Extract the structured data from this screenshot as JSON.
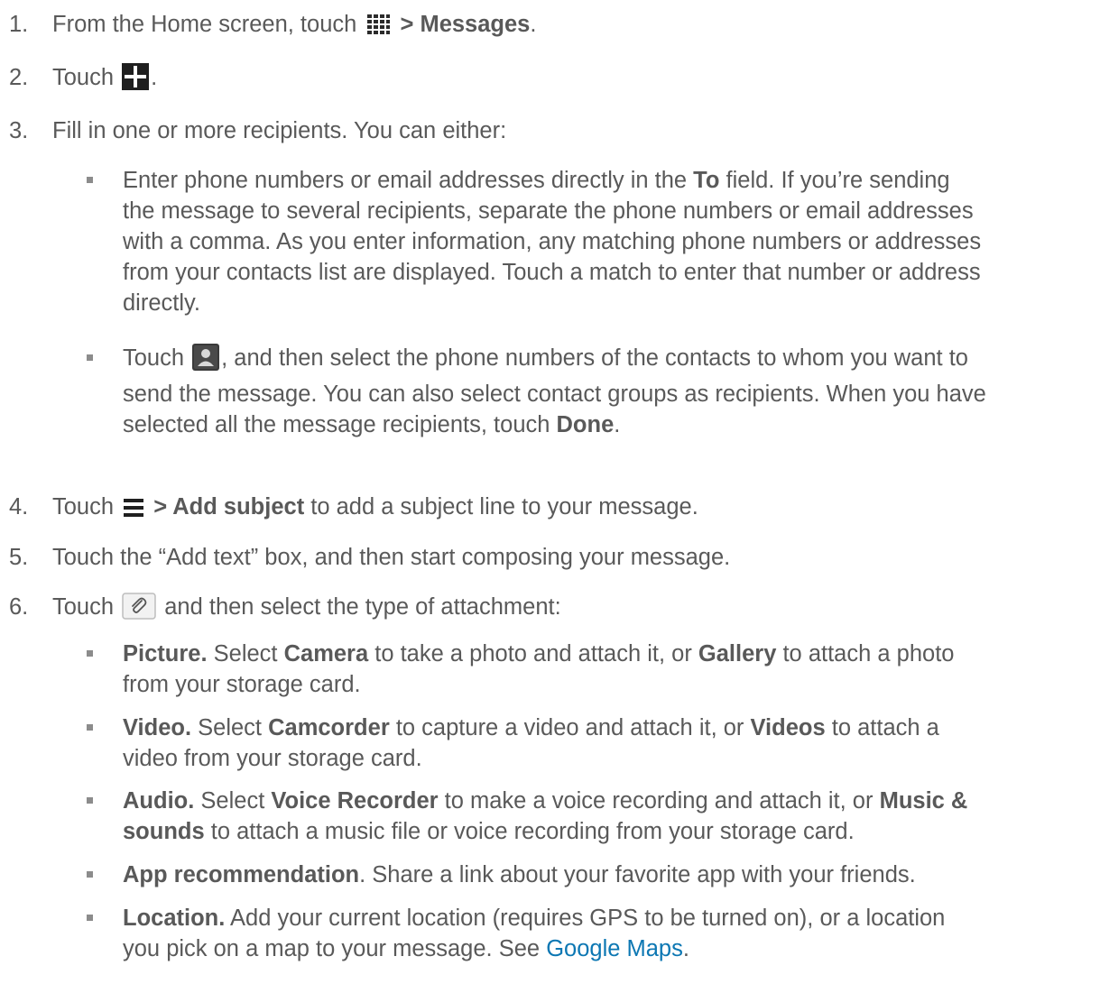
{
  "steps": [
    {
      "num": "1.",
      "a": "From the Home screen, touch ",
      "b": " > Messages",
      "c": "."
    },
    {
      "num": "2.",
      "a": "Touch ",
      "c": "."
    },
    {
      "num": "3.",
      "a": "Fill in one or more recipients. You can either:"
    },
    {
      "num": "4.",
      "a": "Touch ",
      "b": " > Add subject",
      "c": " to add a subject line to your message."
    },
    {
      "num": "5.",
      "a": "Touch the “Add text” box, and then start composing your message."
    },
    {
      "num": "6.",
      "a": "Touch ",
      "c": " and then select the type of attachment:"
    }
  ],
  "recipients_bullets": [
    {
      "l1a": "Enter phone numbers or email addresses directly in the ",
      "l1b": "To",
      "l1c": " field. If you’re sending",
      "l2": "the message to several recipients, separate the phone numbers or email addresses",
      "l3": "with a comma. As you enter information, any matching phone numbers or addresses",
      "l4": "from your contacts list are displayed. Touch a match to enter that number or address",
      "l5": "directly."
    },
    {
      "l1a": "Touch ",
      "l1c": ", and then select the phone numbers of the contacts to whom you want to",
      "l2": "send the message. You can also select contact groups as recipients. When you have",
      "l3a": "selected all the message recipients, touch ",
      "l3b": "Done",
      "l3c": "."
    }
  ],
  "attachment_bullets": [
    {
      "b1": "Picture.",
      "t1": " Select ",
      "b2": "Camera",
      "t2": " to take a photo and attach it, or ",
      "b3": "Gallery",
      "t3": " to attach a photo",
      "l2": "from your storage card."
    },
    {
      "b1": "Video.",
      "t1": " Select ",
      "b2": "Camcorder",
      "t2": " to capture a video and attach it, or ",
      "b3": "Videos",
      "t3": " to attach a",
      "l2": "video from your storage card."
    },
    {
      "b1": "Audio.",
      "t1": " Select ",
      "b2": "Voice Recorder",
      "t2": " to make a voice recording and attach it, or ",
      "b3": "Music &",
      "l2b": "sounds",
      "l2": " to attach a music file or voice recording from your storage card."
    },
    {
      "b1": "App recommendation",
      "t1": ". Share a link about your favorite app with your friends."
    },
    {
      "b1": "Location.",
      "t1": " Add your current location (requires GPS to be turned on), or a location",
      "l2": "you pick on a map to your message. See ",
      "link": "Google Maps",
      "l2end": "."
    }
  ],
  "icons": {
    "apps": "apps-grid-icon",
    "compose": "plus-icon",
    "contact": "contact-person-icon",
    "menu": "menu-icon",
    "attach": "paperclip-icon"
  },
  "colors": {
    "text": "#595959",
    "link": "#0c77b3",
    "bullet": "#8c8c8c"
  }
}
